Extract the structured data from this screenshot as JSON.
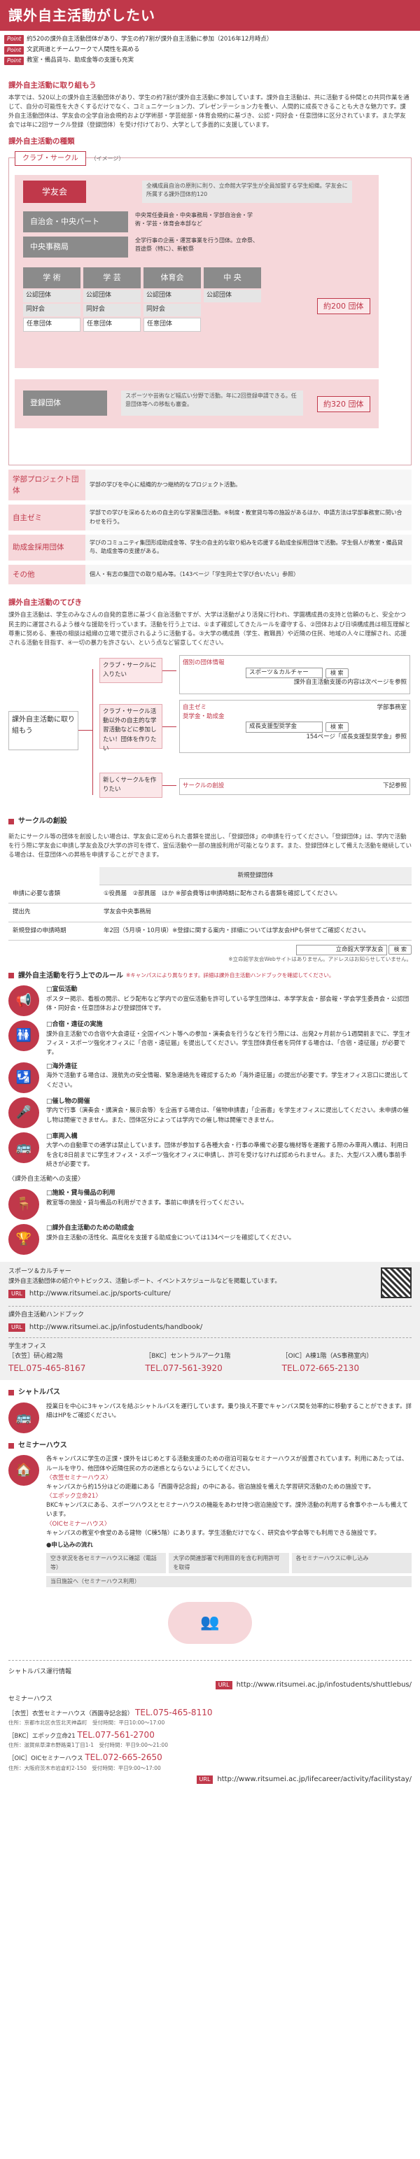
{
  "header": {
    "title": "課外自主活動がしたい"
  },
  "points": [
    {
      "badge": "Point",
      "text": "約520の課外自主活動団体があり、学生の約7割が課外自主活動に参加（2016年12月時点）"
    },
    {
      "badge": "Point",
      "text": "文武両道とチームワークで人間性を高める"
    },
    {
      "badge": "Point",
      "text": "教室・備品貸与、助成金等の支援も充実"
    }
  ],
  "intro": {
    "title": "課外自主活動に取り組もう",
    "body": "本学では、520以上の課外自主活動団体があり、学生の約7割が課外自主活動に参加しています。課外自主活動は、共に活動する仲間との共同作業を通じて、自分の可能性を大きくするだけでなく、コミュニケーション力、プレゼンテーション力を養い、人間的に成長できることも大きな魅力です。課外自主活動団体は、学友会の全学自治会規約および学術部・学芸総部・体育会規約に基づき、公認・同好会・任意団体に区分されています。また学友会では年に2回サークル登録（登録団体）を受け付けており、大学として多面的に支援しています。"
  },
  "types": {
    "title": "課外自主活動の種類",
    "club_tag": "クラブ・サークル",
    "club_note": "（イメージ）",
    "gakuyukai": "学友会",
    "gakuyukai_desc": "全構成員自治の原則に則り、立命館大学学生が全員加盟する学生組織。学友会に所属する課外団体約120",
    "jichikai": "自治会・中央パート",
    "jichikai_desc": "中央常任委員会・中央事務局・学部自治会・学術・学芸・体育会本部など",
    "chuo": "中央事務局",
    "chuo_desc": "全学行事の企画・運営事業を行う団体。立命祭、首途祭（特に）、新歓祭",
    "cols": [
      "学 術",
      "学 芸",
      "体育会",
      "中 央"
    ],
    "sub_koninn": "公認団体",
    "sub_dokou": "同好会",
    "sub_nini": "任意団体",
    "count_a": "約200 団体",
    "touroku": "登録団体",
    "touroku_desc": "スポーツや芸術など幅広い分野で活動。年に2回登録申請できる。任意団体等への移転も審査。",
    "count_b": "約320 団体"
  },
  "orgs": [
    {
      "label": "学部プロジェクト団体",
      "desc": "学部の学びを中心に組織的かつ継続的なプロジェクト活動。"
    },
    {
      "label": "自主ゼミ",
      "desc": "学部での学びを深めるための自主的な学習集団活動。※制度・教室貸与等の施設があるほか、申請方法は学部事務室に問い合わせを行う。"
    },
    {
      "label": "助成金採用団体",
      "desc": "学びのコミュニティ集団形成助成金等、学生の自主的な取り組みを応援する助成金採用団体で活動。学生個人が教室・備品貸与、助成金等の支援がある。"
    },
    {
      "label": "その他",
      "desc": "個人・有志の集団での取り組み等。（143ページ「学生同士で学び合いたい」参照）"
    }
  ],
  "flowsec": {
    "title": "課外自主活動のてびき",
    "body": "課外自主活動は、学生のみなさんの自発的意思に基づく自治活動ですが、大学は活動がより活発に行われ、学園構成員の支持と信頼のもと、安全かつ民主的に運営されるよう様々な援助を行っています。活動を行う上では、①まず確認してきたルールを遵守する、②団体および日頃構成員は相互理解と尊重に努める、重視の相談は組織の立場で提示されるように活動する。③大学の構成員（学生、教職員）や近隣の住民、地域の人々に理解され、応援される活動を目指す、④一切の暴力を許さない、という点など留意してください。",
    "start": "課外自主活動に取り組もう",
    "b1": "クラブ・サークルに入りたい",
    "b2": "クラブ・サークル活動以外の自主的な学習活動などに参加したい！団体を作りたい",
    "b3": "新しくサークルを作りたい",
    "r1_title": "個別の団体情報",
    "r1_input": "スポーツ＆カルチャー",
    "r1_btn": "検 索",
    "r1_note": "課外自主活動支援の内容は次ページを参照",
    "r2_title": "自主ゼミ",
    "r2_side": "学部事務室",
    "r3_title": "奨学金・助成金",
    "r3_input": "成長支援型奨学金",
    "r3_btn": "検 索",
    "r3_note": "154ページ「成長支援型奨学金」参照",
    "r4_title": "サークルの創設",
    "r4_side": "下記参照"
  },
  "create": {
    "title": "サークルの創設",
    "body": "新たにサークル等の団体を創設したい場合は、学友会に定められた書類を提出し、「登録団体」の申請を行ってください。「登録団体」は、学内で活動を行う際に学友会に申請し学友会及び大学の許可を得て、宣伝活動や一部の施設利用が可能となります。また、登録団体として備えた活動を継続している場合は、任意団体への昇格を申請することができます。",
    "table_head": "新規登録団体",
    "rows": [
      {
        "k": "申請に必要な書類",
        "v": "①役員届　②部員届　ほか ※部会費等は申請時期に配布される書類を確認してください。"
      },
      {
        "k": "提出先",
        "v": "学友会中央事務局"
      },
      {
        "k": "新規登録の申請時期",
        "v": "年2回（5月頃・10月頃）※登録に関する案内・詳細については学友会HPも併せてご確認ください。"
      }
    ],
    "search_input": "立命館大学学友会",
    "search_btn": "検 索",
    "search_note": "※立命館学友会Webサイトはありません。アドレスはお知らせしていません。"
  },
  "rules": {
    "title": "課外自主活動を行う上でのルール",
    "title_note": "※キャンパスにより異なります。詳細は課外自主活動ハンドブックを確認してください。",
    "items": [
      {
        "icon": "📢",
        "name": "megaphone-icon",
        "t": "□宣伝活動",
        "d": "ポスター掲示、看板の開示、ビラ配布など学内での宣伝活動を許可している学生団体は、本学学友会・部会報・学会学生委員会・公認団体・同好会・任意団体および登録団体です。"
      },
      {
        "icon": "🚻",
        "name": "meeting-icon",
        "t": "□合宿・遠征の実施",
        "d": "課外自主活動での合宿や大会遠征・全国イベント等への参加・演奏会を行うなどを行う際には、出発2ヶ月前から1週間前までに、学生オフィス・スポーツ強化オフィスに「合宿・遠征届」を提出してください。学生団体責任者を同伴する場合は、「合宿・遠征届」が必要です。"
      },
      {
        "icon": "🛂",
        "name": "passport-icon",
        "t": "□海外遠征",
        "d": "海外で活動する場合は、渡航先の安全情報、緊急連絡先を確認するため「海外遠征届」の提出が必要です。学生オフィス窓口に提出してください。"
      },
      {
        "icon": "🎤",
        "name": "event-icon",
        "t": "□催し物の開催",
        "d": "学内で行事（演奏会・講演会・展示会等）を企画する場合は、「催物申請書」「企画書」を学生オフィスに提出してください。未申請の催し物は開催できません。また、団体区分によっては学内での催し物は開催できません。"
      },
      {
        "icon": "🚌",
        "name": "car-icon",
        "t": "□車両入構",
        "d": "大学への自動車での通学は禁止しています。団体が参加する各種大会・行事の準備で必要な機材等を運搬する際のみ車両入構は、利用日を含む8日前までに学生オフィス・スポーツ強化オフィスに申請し、許可を受けなければ認められません。また、大型バス入構も事前手続きが必要です。"
      }
    ],
    "support_title": "〈課外自主活動への支援〉",
    "support": [
      {
        "icon": "🪑",
        "name": "facility-icon",
        "t": "□施設・貸与備品の利用",
        "d": "教室等の施設・貸与備品の利用ができます。事前に申請を行ってください。"
      },
      {
        "icon": "🏆",
        "name": "grant-icon",
        "t": "□課外自主活動のための助成金",
        "d": "課外自主活動の活性化、高度化を支援する助成金については134ページを確認してください。"
      }
    ]
  },
  "refs": {
    "l1_title": "スポーツ＆カルチャー",
    "l1_body": "課外自主活動団体の紹介やトピックス、活動レポート、イベントスケジュールなどを掲載しています。",
    "l1_url_badge": "URL",
    "l1_url": "http://www.ritsumei.ac.jp/sports-culture/",
    "l2_title": "課外自主活動ハンドブック",
    "l2_url_badge": "URL",
    "l2_url": "http://www.ritsumei.ac.jp/infostudents/handbook/",
    "office_title": "学生オフィス",
    "offices": [
      {
        "campus": "［衣笠］研心館2階",
        "tel": "TEL.075-465-8167"
      },
      {
        "campus": "［BKC］セントラルアーク1階",
        "tel": "TEL.077-561-3920"
      },
      {
        "campus": "［OIC］A棟1階（AS事務室内）",
        "tel": "TEL.072-665-2130"
      }
    ]
  },
  "shuttle": {
    "title": "シャトルバス",
    "body": "授業日を中心に3キャンパスを結ぶシャトルバスを運行しています。乗り換え不要でキャンパス間を効率的に移動することができます。詳細はHPをご確認ください。"
  },
  "seminar": {
    "title": "セミナーハウス",
    "body": "各キャンパスに学生の正課・課外をはじめとする活動支援のための宿泊可能なセミナーハウスが設置されています。利用にあたっては、ルールを守り、他団体や近隣住民の方の迷惑とならないようにしてください。",
    "kinugasa_t": "〈衣笠セミナーハウス〉",
    "kinugasa_d": "キャンパスから約15分ほどの距離にある「西園寺記念館」の中にある。宿泊施設を備えた学習研究活動のための施設です。",
    "bkc_t": "〈エポック立命21〉",
    "bkc_d": "BKCキャンパスにある、スポーツハウスとセミナーハウスの機能をあわせ持つ宿泊施設です。課外活動の利用する食事やホールも備えています。",
    "oic_t": "〈OICセミナーハウス〉",
    "oic_d": "キャンパスの教室や食堂のある建物（C棟5階）にあります。学生活動だけでなく、研究会や学会等でも利用できる施設です。",
    "apply_t": "●申し込みの流れ",
    "steps": [
      "空き状況を各セミナーハウスに確認（電話等）",
      "大学の関連部署で利用目的を含む利用許可を取得",
      "各セミナーハウスに申し込み"
    ],
    "final_step": "当日施設へ（セミナーハウス利用）"
  },
  "footer": {
    "shuttle_title": "シャトルバス運行情報",
    "shuttle_url_badge": "URL",
    "shuttle_url": "http://www.ritsumei.ac.jp/infostudents/shuttlebus/",
    "sem_title": "セミナーハウス",
    "sem_rows": [
      {
        "k": "［衣笠］衣笠セミナーハウス（西園寺記念館）",
        "tel": "TEL.075-465-8110",
        "addr": "住所：京都市北区衣笠北天神森町　受付時間：平日10:00〜17:00"
      },
      {
        "k": "［BKC］エポック立命21",
        "tel": "TEL.077-561-2700",
        "addr": "住所：滋賀県草津市野路東1丁目1-1　受付時間：平日9:00〜21:00"
      },
      {
        "k": "［OIC］OICセミナーハウス",
        "tel": "TEL.072-665-2650",
        "addr": "住所：大阪府茨木市岩倉町2-150　受付時間：平日9:00〜17:00"
      }
    ],
    "sem_url_badge": "URL",
    "sem_url": "http://www.ritsumei.ac.jp/lifecareer/activity/facilitystay/"
  }
}
